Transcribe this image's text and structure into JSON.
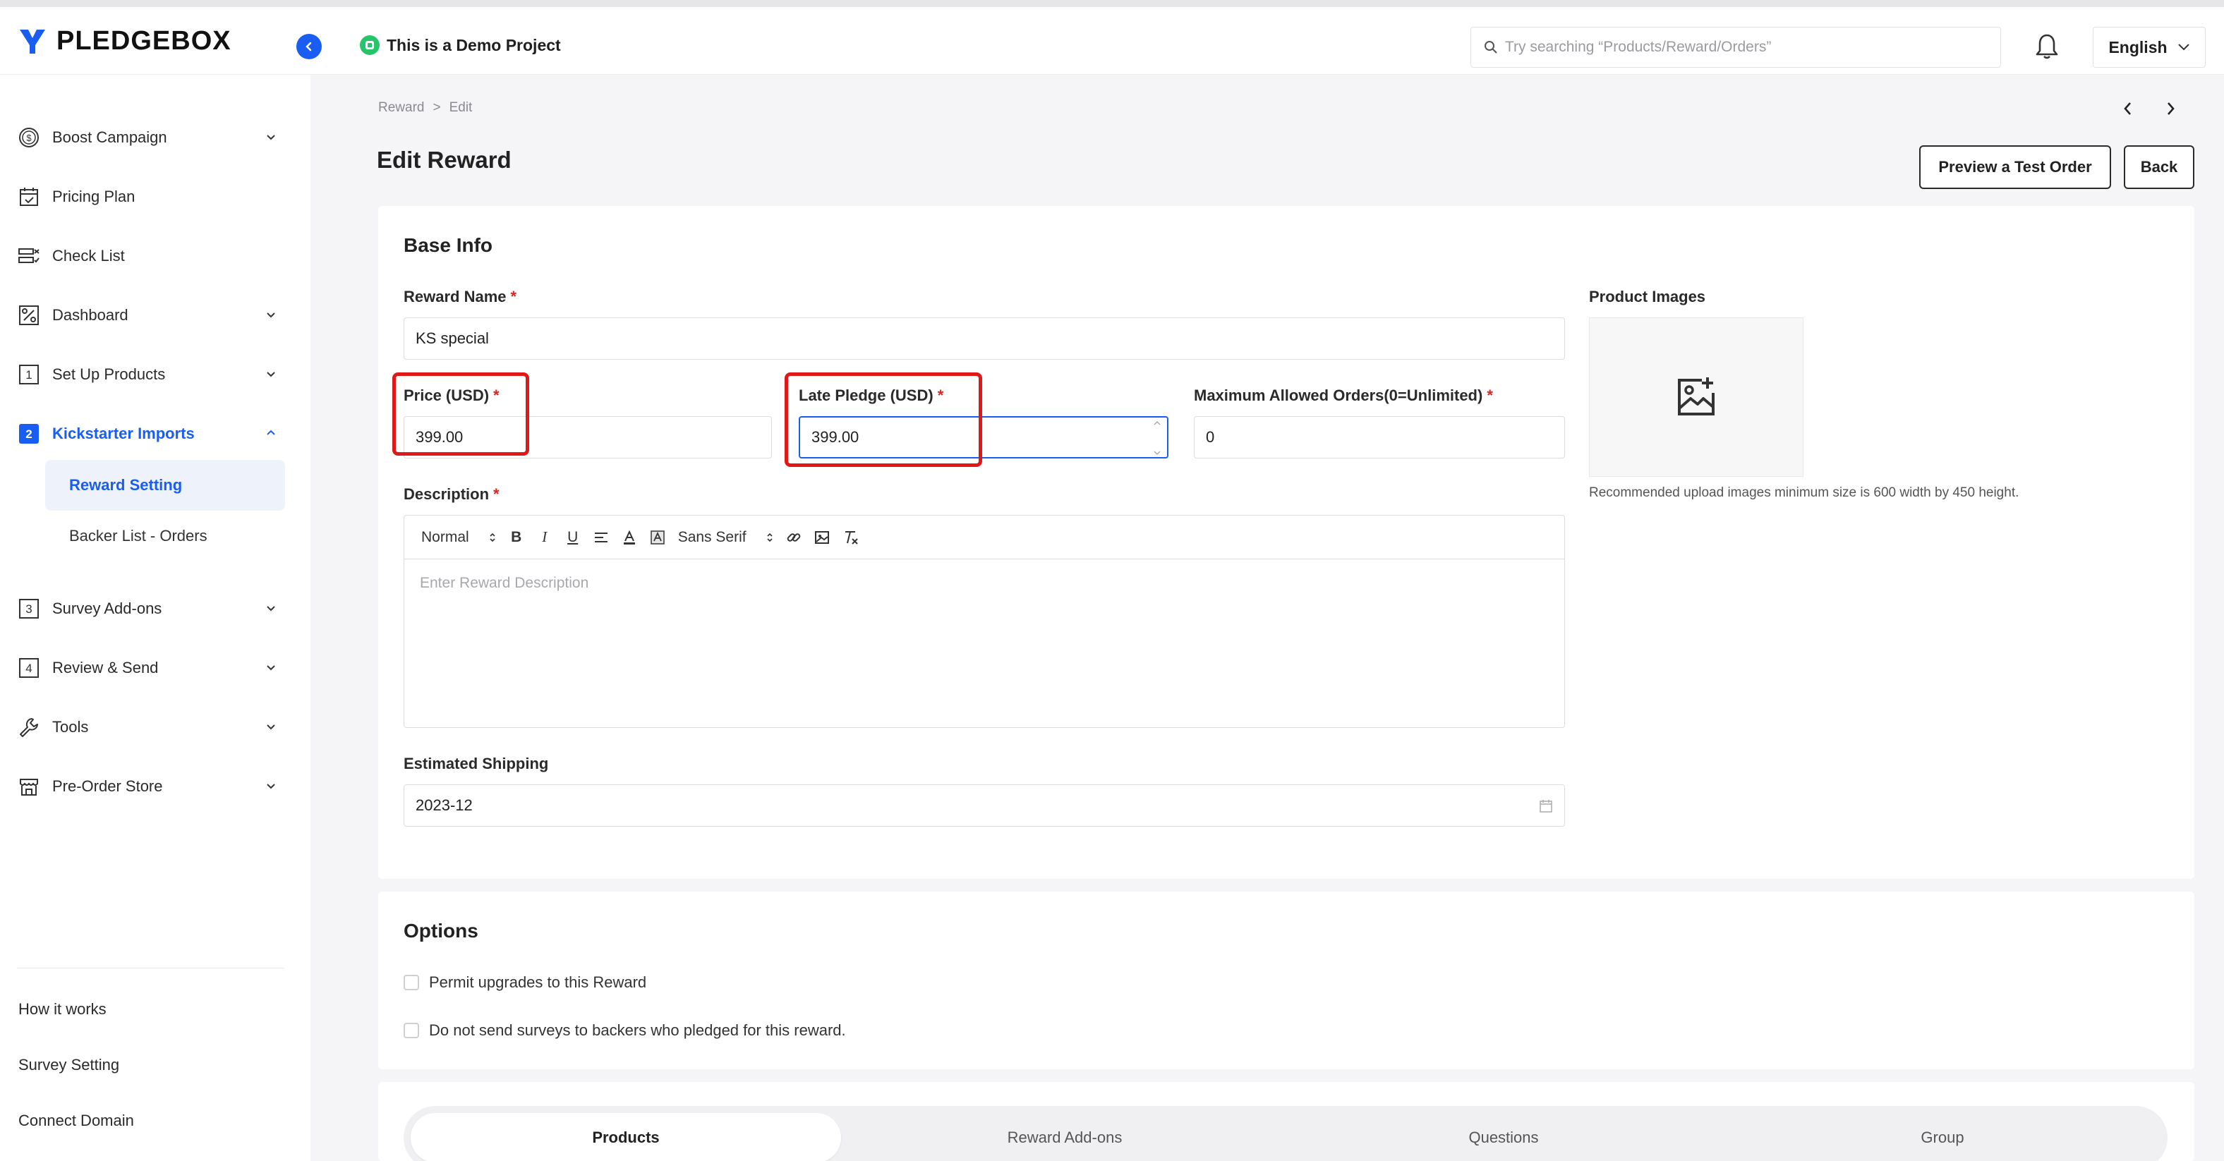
{
  "brand": {
    "name": "PLEDGEBOX",
    "accent": "#1a5df2"
  },
  "header": {
    "demo_label": "This is a Demo Project",
    "search_placeholder": "Try searching “Products/Reward/Orders”",
    "language": "English"
  },
  "sidebar": {
    "items": [
      {
        "label": "Boost Campaign",
        "icon": "dollar-circle-icon"
      },
      {
        "label": "Pricing Plan",
        "icon": "calendar-check-icon"
      },
      {
        "label": "Check List",
        "icon": "checklist-icon"
      },
      {
        "label": "Dashboard",
        "icon": "percent-chart-icon"
      },
      {
        "label": "Set Up Products",
        "icon": "step-1-icon"
      },
      {
        "label": "Kickstarter Imports",
        "icon": "step-2-icon"
      },
      {
        "label": "Survey Add-ons",
        "icon": "step-3-icon"
      },
      {
        "label": "Review & Send",
        "icon": "step-4-icon"
      },
      {
        "label": "Tools",
        "icon": "wrench-icon"
      },
      {
        "label": "Pre-Order Store",
        "icon": "store-icon"
      }
    ],
    "sub_items": [
      {
        "label": "Reward Setting"
      },
      {
        "label": "Backer List - Orders"
      }
    ],
    "footer_links": [
      "How it works",
      "Survey Setting",
      "Connect Domain"
    ]
  },
  "breadcrumb": {
    "parent": "Reward",
    "sep": ">",
    "current": "Edit"
  },
  "page": {
    "title": "Edit Reward",
    "preview_button": "Preview a Test Order",
    "back_button": "Back"
  },
  "base_info": {
    "title": "Base Info",
    "reward_name_label": "Reward Name",
    "reward_name_value": "KS special",
    "price_label": "Price (USD)",
    "price_value": "399.00",
    "late_pledge_label": "Late Pledge (USD)",
    "late_pledge_value": "399.00",
    "max_orders_label": "Maximum Allowed Orders(0=Unlimited)",
    "max_orders_value": "0",
    "description_label": "Description",
    "description_placeholder": "Enter Reward Description",
    "editor_toolbar": {
      "style": "Normal",
      "font": "Sans Serif"
    },
    "shipping_label": "Estimated Shipping",
    "shipping_value": "2023-12",
    "product_images_label": "Product Images",
    "images_note": "Recommended upload images minimum size is 600 width by 450 height.",
    "required_mark": "*"
  },
  "options": {
    "title": "Options",
    "permit_upgrades": "Permit upgrades to this Reward",
    "no_surveys": "Do not send surveys to backers who pledged for this reward."
  },
  "tabs": [
    "Products",
    "Reward Add-ons",
    "Questions",
    "Group"
  ]
}
